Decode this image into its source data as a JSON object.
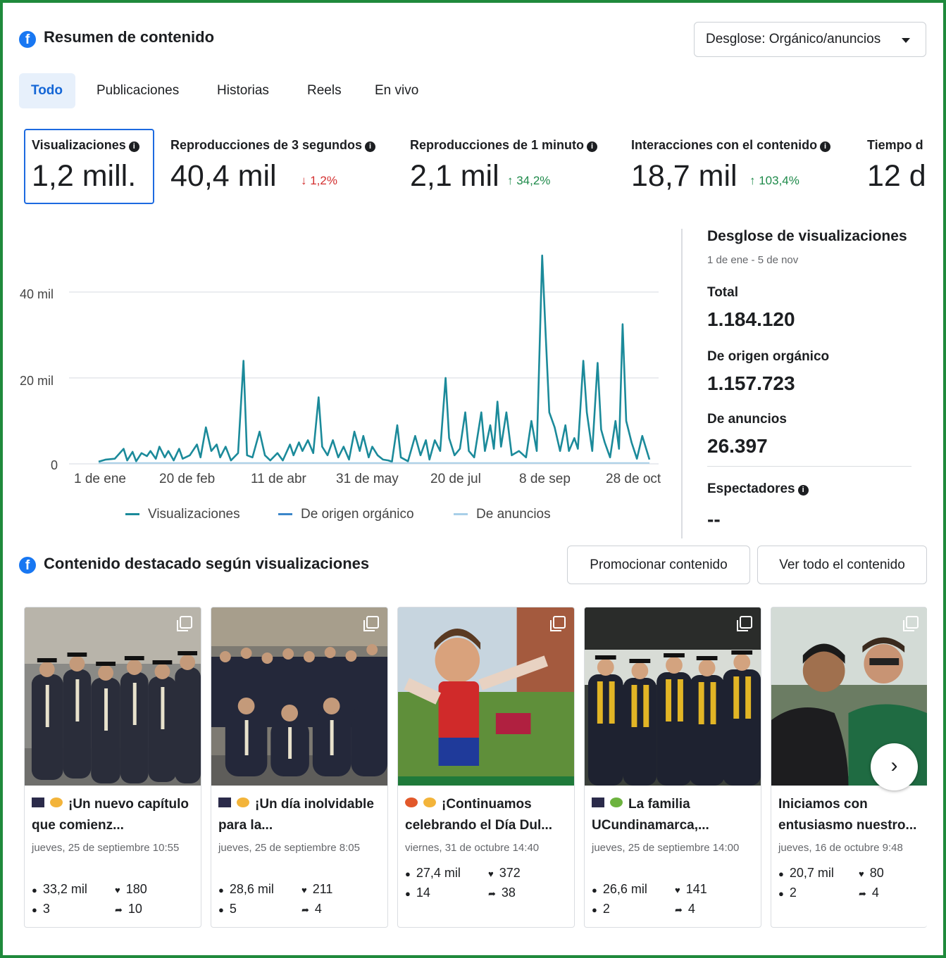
{
  "header": {
    "title": "Resumen de contenido",
    "dropdown_label": "Desglose: Orgánico/anuncios"
  },
  "tabs": [
    "Todo",
    "Publicaciones",
    "Historias",
    "Reels",
    "En vivo"
  ],
  "metrics": [
    {
      "label": "Visualizaciones",
      "value": "1,2 mill.",
      "change": ""
    },
    {
      "label": "Reproducciones de 3 segundos",
      "value": "40,4 mil",
      "change": "↓ 1,2%"
    },
    {
      "label": "Reproducciones de 1 minuto",
      "value": "2,1 mil",
      "change": "↑ 34,2%"
    },
    {
      "label": "Interacciones con el contenido",
      "value": "18,7 mil",
      "change": "↑ 103,4%"
    },
    {
      "label": "Tiempo d",
      "value": "12 d",
      "change": ""
    }
  ],
  "chart_data": {
    "type": "line",
    "y_ticks": [
      "0",
      "20 mil",
      "40 mil"
    ],
    "ylim": [
      0,
      48000
    ],
    "x_ticks": [
      "1 de ene",
      "20 de feb",
      "11 de abr",
      "31 de may",
      "20 de jul",
      "8 de sep",
      "28 de oct"
    ],
    "x_range_days": [
      1,
      309
    ],
    "legend": [
      "Visualizaciones",
      "De origen orgánico",
      "De anuncios"
    ],
    "grid": true,
    "series": [
      {
        "name": "Visualizaciones",
        "color": "#1b8a9a",
        "points": [
          [
            1,
            500
          ],
          [
            5,
            1000
          ],
          [
            10,
            1200
          ],
          [
            15,
            3500
          ],
          [
            17,
            800
          ],
          [
            20,
            2800
          ],
          [
            22,
            600
          ],
          [
            25,
            2500
          ],
          [
            28,
            1800
          ],
          [
            30,
            3000
          ],
          [
            33,
            1200
          ],
          [
            35,
            4000
          ],
          [
            38,
            1500
          ],
          [
            40,
            3000
          ],
          [
            43,
            800
          ],
          [
            46,
            3500
          ],
          [
            48,
            1200
          ],
          [
            52,
            2000
          ],
          [
            56,
            4500
          ],
          [
            58,
            1500
          ],
          [
            61,
            8500
          ],
          [
            64,
            3000
          ],
          [
            67,
            4500
          ],
          [
            69,
            1500
          ],
          [
            72,
            4000
          ],
          [
            75,
            800
          ],
          [
            79,
            2500
          ],
          [
            82,
            24000
          ],
          [
            84,
            2000
          ],
          [
            87,
            1500
          ],
          [
            91,
            7500
          ],
          [
            94,
            2000
          ],
          [
            97,
            800
          ],
          [
            101,
            2500
          ],
          [
            104,
            800
          ],
          [
            108,
            4500
          ],
          [
            110,
            2000
          ],
          [
            113,
            5000
          ],
          [
            115,
            3000
          ],
          [
            118,
            5500
          ],
          [
            121,
            2500
          ],
          [
            124,
            15500
          ],
          [
            126,
            4000
          ],
          [
            129,
            2000
          ],
          [
            132,
            5500
          ],
          [
            135,
            1500
          ],
          [
            138,
            4000
          ],
          [
            141,
            1000
          ],
          [
            144,
            7500
          ],
          [
            147,
            3000
          ],
          [
            149,
            6500
          ],
          [
            152,
            1500
          ],
          [
            154,
            4000
          ],
          [
            157,
            2000
          ],
          [
            160,
            1000
          ],
          [
            163,
            800
          ],
          [
            165,
            500
          ],
          [
            168,
            9000
          ],
          [
            170,
            1500
          ],
          [
            174,
            600
          ],
          [
            178,
            6500
          ],
          [
            181,
            2000
          ],
          [
            184,
            5500
          ],
          [
            186,
            1000
          ],
          [
            189,
            5500
          ],
          [
            192,
            3000
          ],
          [
            195,
            20000
          ],
          [
            197,
            6000
          ],
          [
            200,
            2000
          ],
          [
            203,
            3500
          ],
          [
            206,
            12000
          ],
          [
            208,
            3000
          ],
          [
            211,
            1500
          ],
          [
            215,
            12000
          ],
          [
            217,
            3000
          ],
          [
            220,
            9000
          ],
          [
            222,
            3500
          ],
          [
            224,
            14500
          ],
          [
            226,
            4000
          ],
          [
            229,
            12000
          ],
          [
            232,
            2000
          ],
          [
            236,
            3000
          ],
          [
            240,
            1500
          ],
          [
            243,
            10000
          ],
          [
            246,
            3000
          ],
          [
            249,
            48500
          ],
          [
            251,
            30000
          ],
          [
            253,
            12000
          ],
          [
            256,
            8500
          ],
          [
            259,
            3000
          ],
          [
            262,
            9000
          ],
          [
            264,
            3000
          ],
          [
            267,
            6000
          ],
          [
            269,
            3500
          ],
          [
            272,
            24000
          ],
          [
            274,
            12000
          ],
          [
            277,
            3000
          ],
          [
            280,
            23500
          ],
          [
            282,
            8000
          ],
          [
            284,
            5000
          ],
          [
            287,
            1500
          ],
          [
            290,
            10000
          ],
          [
            292,
            3500
          ],
          [
            294,
            32500
          ],
          [
            296,
            10000
          ],
          [
            299,
            5000
          ],
          [
            302,
            1200
          ],
          [
            305,
            6500
          ],
          [
            309,
            1000
          ]
        ]
      },
      {
        "name": "De origen orgánico",
        "color": "#3b86c9",
        "points": []
      },
      {
        "name": "De anuncios",
        "color": "#a8cfe8",
        "points": [
          [
            1,
            200
          ],
          [
            309,
            200
          ]
        ]
      }
    ]
  },
  "breakdown": {
    "title": "Desglose de visualizaciones",
    "range": "1 de ene - 5 de nov",
    "total_label": "Total",
    "total_value": "1.184.120",
    "organic_label": "De origen orgánico",
    "organic_value": "1.157.723",
    "ads_label": "De anuncios",
    "ads_value": "26.397",
    "viewers_label": "Espectadores",
    "viewers_value": "--"
  },
  "featured": {
    "title": "Contenido destacado según visualizaciones",
    "promote_button": "Promocionar contenido",
    "view_all_button": "Ver todo el contenido"
  },
  "cards": [
    {
      "title": "¡Un nuevo capítulo que comienz...",
      "date": "jueves, 25 de septiembre 10:55",
      "views": "33,2 mil",
      "likes": "180",
      "comments": "3",
      "shares": "10",
      "emoji": [
        "graduation-cap-icon",
        "sparkles-icon"
      ]
    },
    {
      "title": "¡Un día inolvidable para la...",
      "date": "jueves, 25 de septiembre 8:05",
      "views": "28,6 mil",
      "likes": "211",
      "comments": "5",
      "shares": "4",
      "emoji": [
        "graduation-cap-icon",
        "sparkles-icon"
      ]
    },
    {
      "title": "¡Continuamos celebrando el Día Dul...",
      "date": "viernes, 31 de octubre 14:40",
      "views": "27,4 mil",
      "likes": "372",
      "comments": "14",
      "shares": "38",
      "emoji": [
        "pumpkin-icon",
        "sparkles-icon"
      ]
    },
    {
      "title": "La familia UCundinamarca,...",
      "date": "jueves, 25 de septiembre 14:00",
      "views": "26,6 mil",
      "likes": "141",
      "comments": "2",
      "shares": "4",
      "emoji": [
        "graduation-cap-icon",
        "leaf-icon"
      ]
    },
    {
      "title": "Iniciamos con entusiasmo nuestro...",
      "date": "jueves, 16 de octubre 9:48",
      "views": "20,7 mil",
      "likes": "80",
      "comments": "2",
      "shares": "4",
      "emoji": []
    }
  ]
}
